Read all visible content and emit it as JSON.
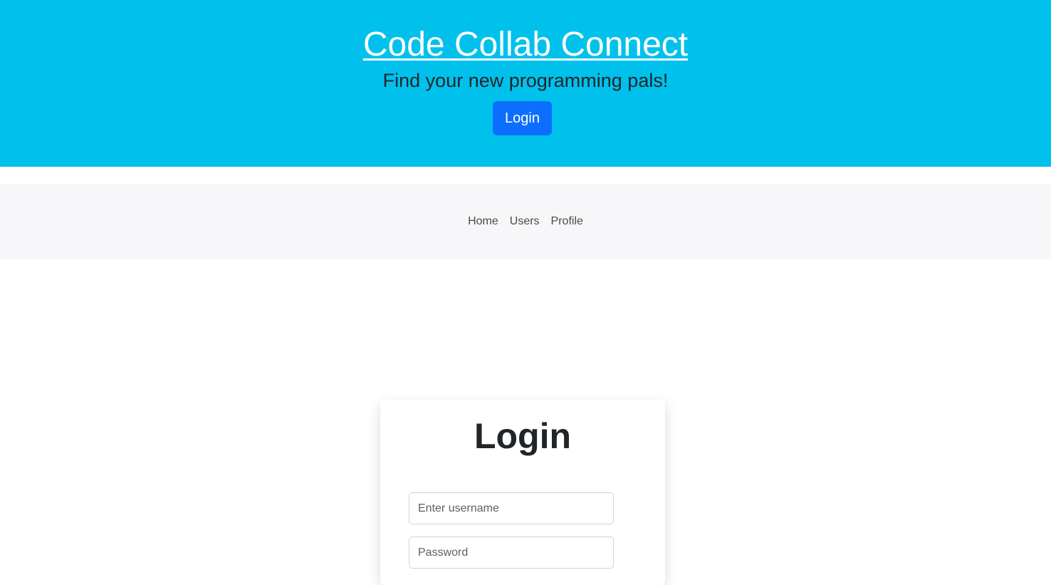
{
  "hero": {
    "title": "Code Collab Connect",
    "subtitle": "Find your new programming pals!",
    "login_label": "Login"
  },
  "nav": {
    "items": [
      {
        "label": "Home"
      },
      {
        "label": "Users"
      },
      {
        "label": "Profile"
      }
    ]
  },
  "login_card": {
    "title": "Login",
    "username_placeholder": "Enter username",
    "username_value": "",
    "password_placeholder": "Password",
    "password_value": ""
  },
  "colors": {
    "hero_bg": "#00c1ec",
    "button_primary": "#0d6efd",
    "nav_bg": "#f7f7f9"
  }
}
